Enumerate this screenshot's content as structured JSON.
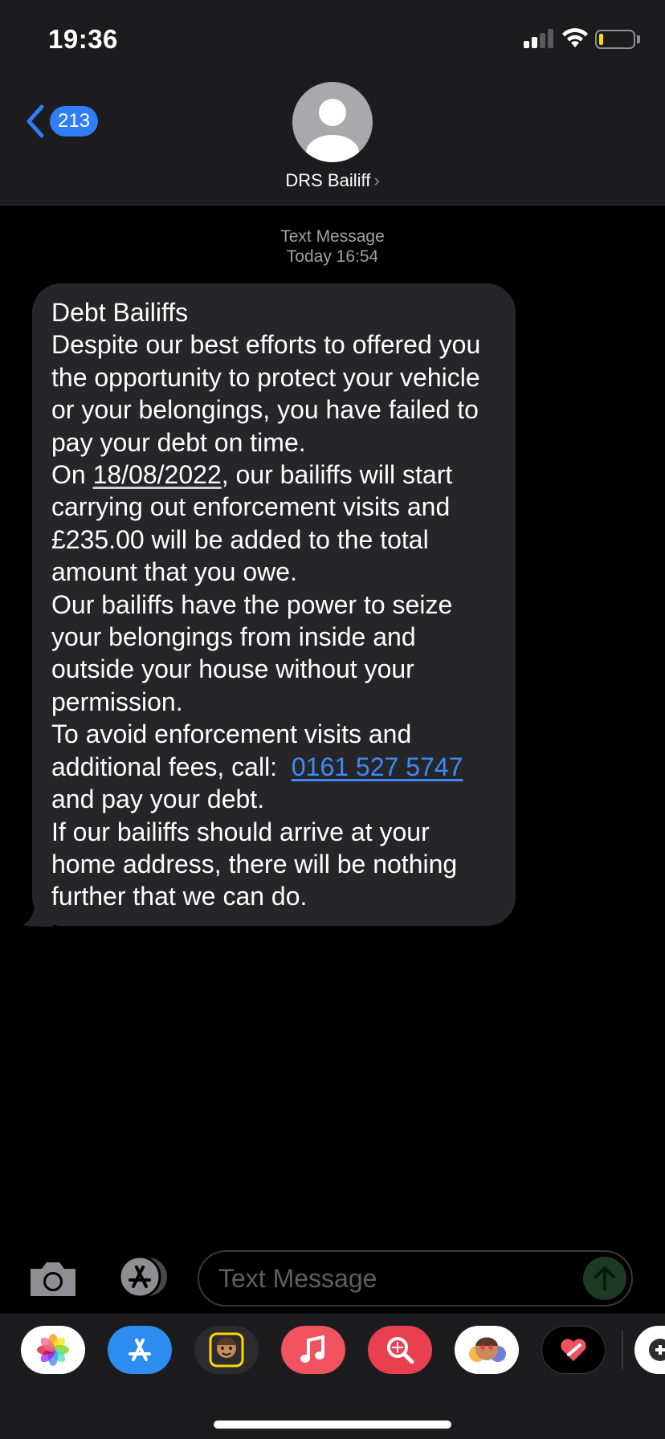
{
  "status_bar": {
    "time": "19:36",
    "battery_level": 0.12,
    "battery_color": "#ffd60a"
  },
  "header": {
    "back_icon": "chevron-left-icon",
    "unread_count": "213",
    "contact_name": "DRS Bailiff",
    "contact_chevron": "›",
    "avatar_icon": "person-icon"
  },
  "conversation": {
    "service_label": "Text Message",
    "timestamp": "Today 16:54",
    "message": {
      "title": "Debt Bailiffs",
      "para1": "Despite our best efforts to offered you the opportunity to protect your vehicle or your belongings, you have failed to pay your debt on time.",
      "para2_prefix": "On ",
      "para2_date": "18/08/2022",
      "para2_suffix": ", our bailiffs will start carrying out enforcement visits and £235.00 will be added to the total amount that you owe.",
      "para3": "Our bailiffs have the power to seize your belongings from inside and outside your house without your permission.",
      "para4_prefix": "To avoid enforcement visits and additional fees, call:",
      "phone": "0161 527 5747",
      "para4_suffix": "and pay your debt.",
      "para5": "If our bailiffs should arrive at your home address, there will be nothing further that we can do."
    },
    "bubble_color": "#262628",
    "link_color": "#3e8af7"
  },
  "compose": {
    "camera_icon": "camera-icon",
    "apps_icon": "app-store-icon",
    "placeholder": "Text Message",
    "send_icon": "send-arrow-icon"
  },
  "app_drawer": {
    "apps": [
      "photos-icon",
      "app-store-icon",
      "memoji-stickers-icon",
      "music-icon",
      "web-images-search-icon",
      "memoji-icon",
      "digital-touch-icon",
      "game-icon"
    ]
  }
}
